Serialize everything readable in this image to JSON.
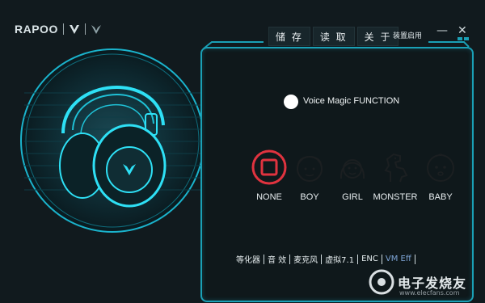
{
  "brand": {
    "name": "RAPOO"
  },
  "menu": {
    "save": "储 存",
    "read": "读 取",
    "about": "关 于"
  },
  "apply_label": "装置启用",
  "window": {
    "minimize": "—",
    "close": "✕"
  },
  "voice_magic": {
    "label": "Voice Magic FUNCTION"
  },
  "options": [
    {
      "label": "NONE"
    },
    {
      "label": "BOY"
    },
    {
      "label": "GIRL"
    },
    {
      "label": "MONSTER"
    },
    {
      "label": "BABY"
    }
  ],
  "tabs": [
    "等化器",
    "音 效",
    "麦克风",
    "虚拟7.1",
    "ENC",
    "VM Eff"
  ],
  "watermark": {
    "text": "电子发烧友",
    "subtext": "www.elecfans.com"
  },
  "colors": {
    "accent": "#1ec8e0",
    "selected": "#e0333f",
    "active_tab": "#7fa6d8"
  }
}
